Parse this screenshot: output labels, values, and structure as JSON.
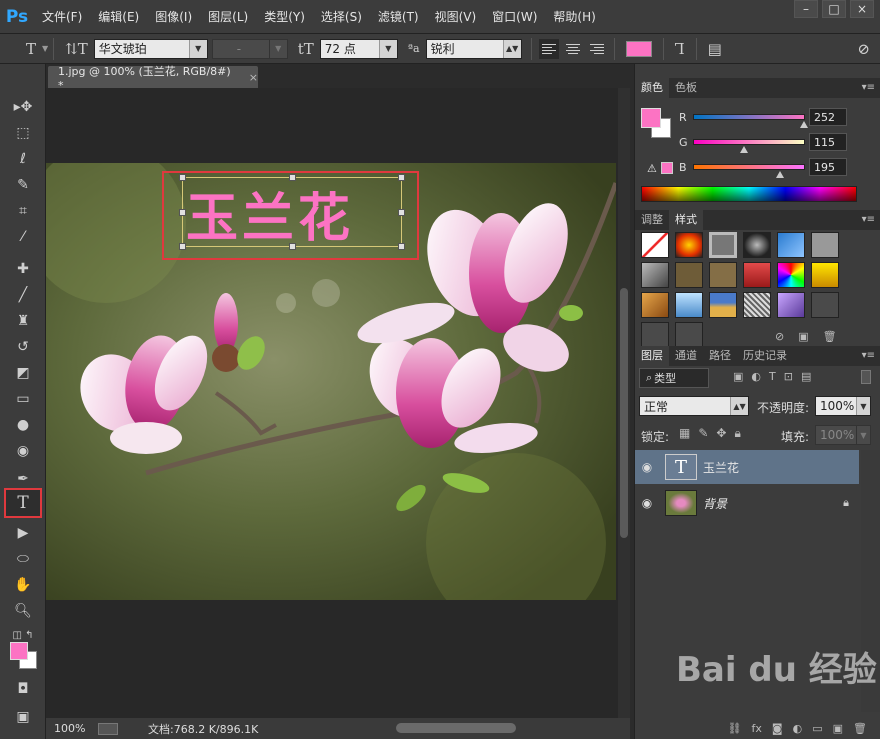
{
  "app": {
    "logo": "Ps",
    "menu": [
      "文件(F)",
      "编辑(E)",
      "图像(I)",
      "图层(L)",
      "类型(Y)",
      "选择(S)",
      "滤镜(T)",
      "视图(V)",
      "窗口(W)",
      "帮助(H)"
    ],
    "window_controls": [
      "–",
      "□",
      "×"
    ]
  },
  "options_bar": {
    "font_family": "华文琥珀",
    "font_style": "-",
    "font_size": "72 点",
    "aa_label": "ªa",
    "antialias": "锐利",
    "text_color": "#fc73c3"
  },
  "document": {
    "tab_title": "1.jpg @ 100% (玉兰花, RGB/8#) *",
    "overlay_text": "玉兰花",
    "zoom": "100%",
    "doc_info": "文档:768.2 K/896.1K"
  },
  "color_panel": {
    "tabs": [
      "颜色",
      "色板"
    ],
    "r_label": "R",
    "g_label": "G",
    "b_label": "B",
    "r": "252",
    "g": "115",
    "b": "195",
    "fg_color": "#fc73c3"
  },
  "styles_panel": {
    "tabs": [
      "调整",
      "样式"
    ]
  },
  "layers_panel": {
    "tabs": [
      "图层",
      "通道",
      "路径",
      "历史记录"
    ],
    "filter_kind": "类型",
    "blend_mode": "正常",
    "opacity_label": "不透明度:",
    "opacity": "100%",
    "lock_label": "锁定:",
    "fill_label": "填充:",
    "fill": "100%",
    "layers": [
      {
        "name": "玉兰花",
        "type": "text",
        "selected": true
      },
      {
        "name": "背景",
        "type": "image",
        "locked": true
      }
    ]
  },
  "watermark": "Bai du 经验"
}
